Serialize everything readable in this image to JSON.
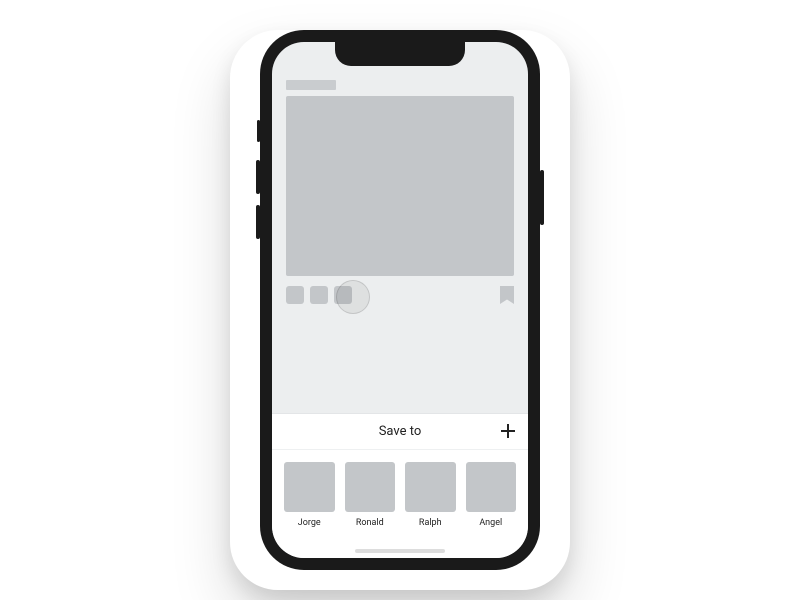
{
  "sheet": {
    "title": "Save to",
    "add_icon": "plus-icon"
  },
  "collections": [
    {
      "label": "Jorge"
    },
    {
      "label": "Ronald"
    },
    {
      "label": "Ralph"
    },
    {
      "label": "Angel"
    }
  ]
}
